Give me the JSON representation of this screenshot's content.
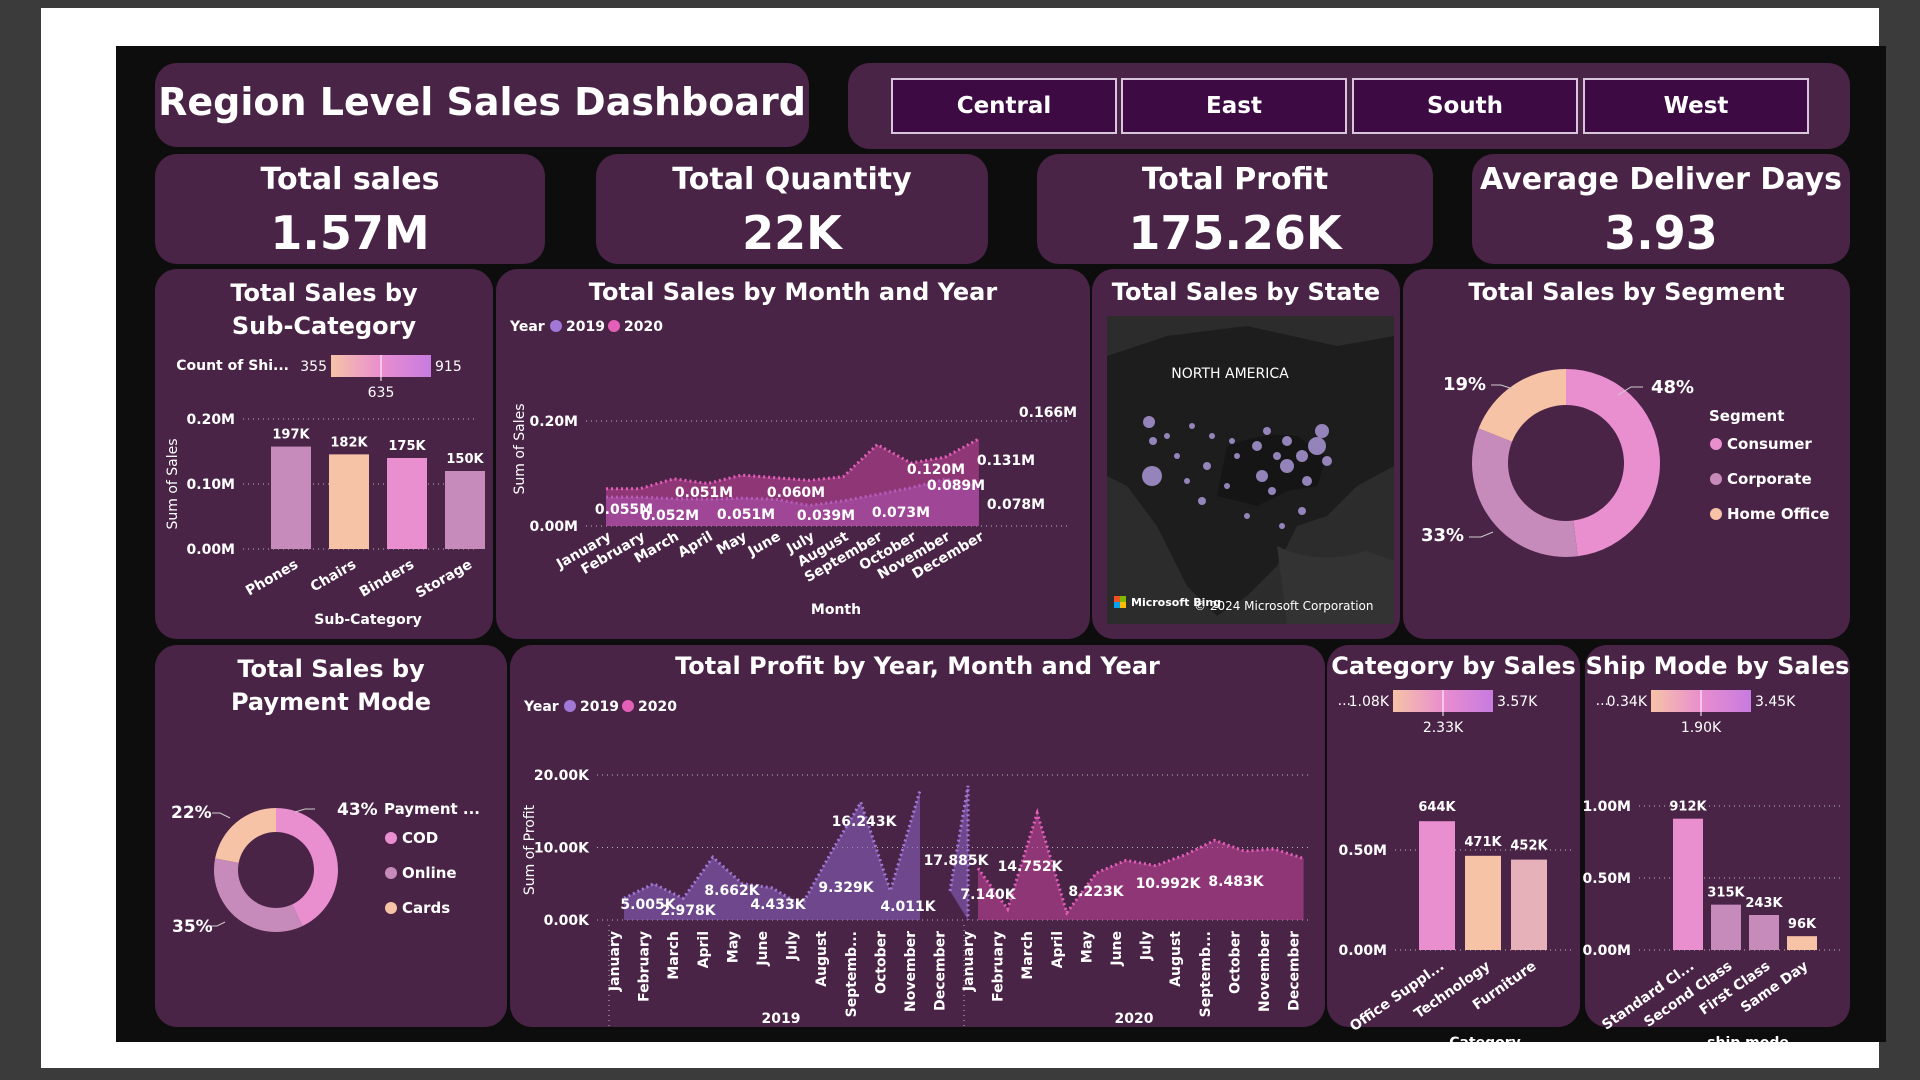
{
  "title": "Region Level Sales Dashboard",
  "slicer": {
    "items": [
      "Central",
      "East",
      "South",
      "West"
    ]
  },
  "kpis": [
    {
      "label": "Total sales",
      "value": "1.57M"
    },
    {
      "label": "Total Quantity",
      "value": "22K"
    },
    {
      "label": "Total Profit",
      "value": "175.26K"
    },
    {
      "label": "Average Deliver Days",
      "value": "3.93"
    }
  ],
  "colors": {
    "pink": "#e98ecf",
    "purple": "#a178d6",
    "peach": "#f6c3a6",
    "mauve": "#c78bbb",
    "rose": "#e6b1b9",
    "card": "#4a2446",
    "magenta": "#e35fb8"
  },
  "titles": {
    "subcat": "Total Sales by Sub-Category",
    "month": "Total Sales by Month and Year",
    "state": "Total Sales by State",
    "segment": "Total Sales by Segment",
    "payment": "Total Sales by Payment Mode",
    "profit": "Total Profit by Year, Month and Year",
    "category": "Category by Sales",
    "shipmode": "Ship Mode by Sales"
  },
  "map": {
    "label": "NORTH AMERICA",
    "credit_brand": "Microsoft Bing",
    "credit": "© 2024 Microsoft Corporation"
  },
  "chart_data": [
    {
      "id": "subcat",
      "type": "bar",
      "categories": [
        "Phones",
        "Chairs",
        "Binders",
        "Storage"
      ],
      "values": [
        197000,
        182000,
        175000,
        150000
      ],
      "data_labels": [
        "197K",
        "182K",
        "175K",
        "150K"
      ],
      "xlabel": "Sub-Category",
      "ylabel": "Sum of Sales",
      "ylim": [
        0,
        0.2
      ],
      "yticks": [
        "0.00M",
        "0.10M",
        "0.20M"
      ],
      "color_legend": {
        "label": "Count of Shi...",
        "min": "355",
        "mid": "635",
        "max": "915"
      }
    },
    {
      "id": "month",
      "type": "area",
      "categories": [
        "January",
        "February",
        "March",
        "April",
        "May",
        "June",
        "July",
        "August",
        "September",
        "October",
        "November",
        "December"
      ],
      "legend_title": "Year",
      "series": [
        {
          "name": "2019",
          "values": [
            0.055,
            0.055,
            0.052,
            0.051,
            0.053,
            0.051,
            0.039,
            0.048,
            0.06,
            0.073,
            0.089,
            0.078
          ]
        },
        {
          "name": "2020",
          "values": [
            0.071,
            0.071,
            0.09,
            0.081,
            0.097,
            0.092,
            0.087,
            0.094,
            0.155,
            0.12,
            0.131,
            0.166
          ]
        }
      ],
      "data_labels": [
        {
          "text": "0.055M"
        },
        {
          "text": "0.052M"
        },
        {
          "text": "0.051M"
        },
        {
          "text": "0.051M"
        },
        {
          "text": "0.060M"
        },
        {
          "text": "0.039M"
        },
        {
          "text": "0.073M"
        },
        {
          "text": "0.120M"
        },
        {
          "text": "0.089M"
        },
        {
          "text": "0.131M"
        },
        {
          "text": "0.078M"
        },
        {
          "text": "0.166M"
        }
      ],
      "xlabel": "Month",
      "ylabel": "Sum of Sales",
      "ylim": [
        0,
        0.2
      ],
      "yticks": [
        "0.00M",
        "0.20M"
      ]
    },
    {
      "id": "segment",
      "type": "pie",
      "categories": [
        "Consumer",
        "Corporate",
        "Home Office"
      ],
      "values": [
        48,
        33,
        19
      ],
      "labels": [
        "48%",
        "33%",
        "19%"
      ],
      "legend_title": "Segment"
    },
    {
      "id": "payment",
      "type": "pie",
      "categories": [
        "COD",
        "Online",
        "Cards"
      ],
      "values": [
        43,
        35,
        22
      ],
      "labels": [
        "43%",
        "35%",
        "22%"
      ],
      "legend_title": "Payment ..."
    },
    {
      "id": "profit",
      "type": "area",
      "categories": [
        "January",
        "February",
        "March",
        "April",
        "May",
        "June",
        "July",
        "August",
        "Septemb...",
        "October",
        "November",
        "December"
      ],
      "legend_title": "Year",
      "year_labels": [
        "2019",
        "2020"
      ],
      "series": [
        {
          "name": "2019",
          "values": [
            3.0,
            5.005,
            2.978,
            8.662,
            5.0,
            4.433,
            2.0,
            9.329,
            16.243,
            4.011,
            17.885,
            null
          ]
        },
        {
          "name": "2020",
          "values": [
            7.14,
            1.5,
            14.752,
            1.0,
            6.5,
            8.223,
            7.5,
            9.0,
            10.992,
            9.5,
            9.8,
            8.483
          ]
        }
      ],
      "data_labels": [
        {
          "text": "5.005K"
        },
        {
          "text": "2.978K"
        },
        {
          "text": "8.662K"
        },
        {
          "text": "4.433K"
        },
        {
          "text": "9.329K"
        },
        {
          "text": "16.243K"
        },
        {
          "text": "4.011K"
        },
        {
          "text": "17.885K"
        },
        {
          "text": "7.140K"
        },
        {
          "text": "14.752K"
        },
        {
          "text": "8.223K"
        },
        {
          "text": "10.992K"
        },
        {
          "text": "8.483K"
        }
      ],
      "xlabel": "Month",
      "ylabel": "Sum of Profit",
      "ylim": [
        0,
        20
      ],
      "yticks": [
        "0.00K",
        "10.00K",
        "20.00K"
      ]
    },
    {
      "id": "category",
      "type": "bar",
      "categories": [
        "Office Suppl...",
        "Technology",
        "Furniture"
      ],
      "values": [
        644000,
        471000,
        452000
      ],
      "data_labels": [
        "644K",
        "471K",
        "452K"
      ],
      "xlabel": "Category",
      "ylim": [
        0,
        0.7
      ],
      "yticks": [
        "0.00M",
        "0.50M"
      ],
      "color_legend": {
        "label": "...",
        "min": "1.08K",
        "mid": "2.33K",
        "max": "3.57K"
      }
    },
    {
      "id": "shipmode",
      "type": "bar",
      "categories": [
        "Standard Cl...",
        "Second Class",
        "First Class",
        "Same Day"
      ],
      "values": [
        912000,
        315000,
        243000,
        96000
      ],
      "data_labels": [
        "912K",
        "315K",
        "243K",
        "96K"
      ],
      "xlabel": "ship mode",
      "ylim": [
        0,
        1.0
      ],
      "yticks": [
        "0.00M",
        "0.50M",
        "1.00M"
      ],
      "color_legend": {
        "label": "...",
        "min": "0.34K",
        "mid": "1.90K",
        "max": "3.45K"
      }
    }
  ]
}
